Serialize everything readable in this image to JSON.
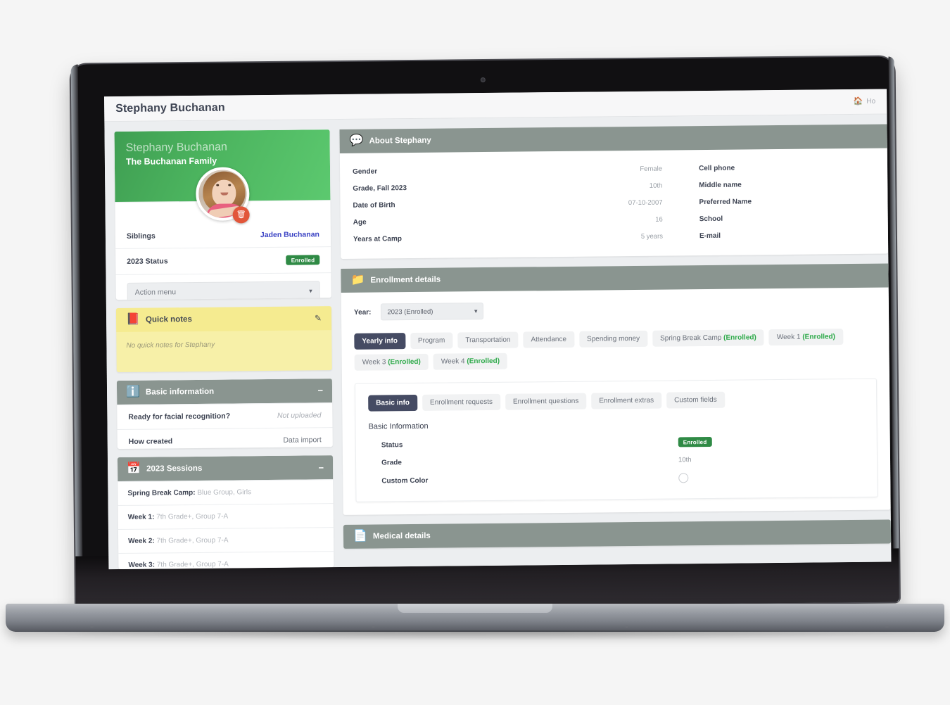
{
  "window": {
    "page_title": "Stephany Buchanan",
    "breadcrumb": {
      "home_icon": "home-icon",
      "label": "Ho"
    }
  },
  "profile": {
    "name": "Stephany Buchanan",
    "family": "The Buchanan Family",
    "avatar_icon": "child-photo-avatar",
    "delete_photo_icon": "trash-icon",
    "rows": [
      {
        "key": "Siblings",
        "value": "Jaden Buchanan",
        "style": "link"
      },
      {
        "key": "2023 Status",
        "value": "Enrolled",
        "style": "badge"
      }
    ],
    "action_menu": {
      "label": "Action menu",
      "caret_icon": "chevron-down-icon"
    }
  },
  "quick_notes": {
    "icon": "notebook-icon",
    "title": "Quick notes",
    "edit_icon": "edit-pencil-icon",
    "empty_text": "No quick notes for Stephany"
  },
  "basic_information": {
    "icon": "info-circle-icon",
    "title": "Basic information",
    "collapse_icon": "minus-icon",
    "rows": [
      {
        "key": "Ready for facial recognition?",
        "value": "Not uploaded",
        "style": "muted-italic"
      },
      {
        "key": "How created",
        "value": "Data import",
        "style": "plain"
      }
    ]
  },
  "sessions": {
    "icon": "calendar-icon",
    "title": "2023 Sessions",
    "collapse_icon": "minus-icon",
    "rows": [
      {
        "label": "Spring Break Camp:",
        "value": " Blue Group, Girls"
      },
      {
        "label": "Week 1:",
        "value": " 7th Grade+, Group 7-A"
      },
      {
        "label": "Week 2:",
        "value": " 7th Grade+, Group 7-A"
      },
      {
        "label": "Week 3:",
        "value": " 7th Grade+, Group 7-A"
      }
    ]
  },
  "about": {
    "icon": "speech-info-icon",
    "title": "About Stephany",
    "left_rows": [
      {
        "key": "Gender",
        "value": "Female"
      },
      {
        "key": "Grade, Fall 2023",
        "value": "10th"
      },
      {
        "key": "Date of Birth",
        "value": "07-10-2007"
      },
      {
        "key": "Age",
        "value": "16"
      },
      {
        "key": "Years at Camp",
        "value": "5 years"
      }
    ],
    "right_rows": [
      {
        "key": "Cell phone",
        "value": ""
      },
      {
        "key": "Middle name",
        "value": ""
      },
      {
        "key": "Preferred Name",
        "value": ""
      },
      {
        "key": "School",
        "value": ""
      },
      {
        "key": "E-mail",
        "value": ""
      }
    ]
  },
  "enrollment": {
    "icon": "folder-icon",
    "title": "Enrollment details",
    "year_label": "Year:",
    "year_value": "2023 (Enrolled)",
    "year_caret_icon": "chevron-down-icon",
    "tabs": [
      {
        "label": "Yearly info",
        "status": "",
        "active": true
      },
      {
        "label": "Program",
        "status": "",
        "active": false
      },
      {
        "label": "Transportation",
        "status": "",
        "active": false
      },
      {
        "label": "Attendance",
        "status": "",
        "active": false
      },
      {
        "label": "Spending money",
        "status": "",
        "active": false
      },
      {
        "label": "Spring Break Camp",
        "status": "(Enrolled)",
        "active": false
      },
      {
        "label": "Week 1",
        "status": "(Enrolled)",
        "active": false
      },
      {
        "label": "Week 3",
        "status": "(Enrolled)",
        "active": false
      },
      {
        "label": "Week 4",
        "status": "(Enrolled)",
        "active": false
      }
    ],
    "subtabs": [
      {
        "label": "Basic info",
        "active": true
      },
      {
        "label": "Enrollment requests",
        "active": false
      },
      {
        "label": "Enrollment questions",
        "active": false
      },
      {
        "label": "Enrollment extras",
        "active": false
      },
      {
        "label": "Custom fields",
        "active": false
      }
    ],
    "basic_info_title": "Basic Information",
    "basic_info_rows": [
      {
        "key": "Status",
        "value": "Enrolled",
        "style": "badge"
      },
      {
        "key": "Grade",
        "value": "10th",
        "style": "plain"
      },
      {
        "key": "Custom Color",
        "value": "",
        "style": "swatch"
      }
    ]
  },
  "medical": {
    "icon": "document-pin-icon",
    "title": "Medical details"
  },
  "colors": {
    "accent_green": "#4bb35e",
    "badge_green": "#2f8a45",
    "panel_header": "#8a9590",
    "active_tab": "#454b63",
    "note_yellow": "#f7f0a8",
    "link_blue": "#3b43c4",
    "delete_red": "#e2563a"
  }
}
